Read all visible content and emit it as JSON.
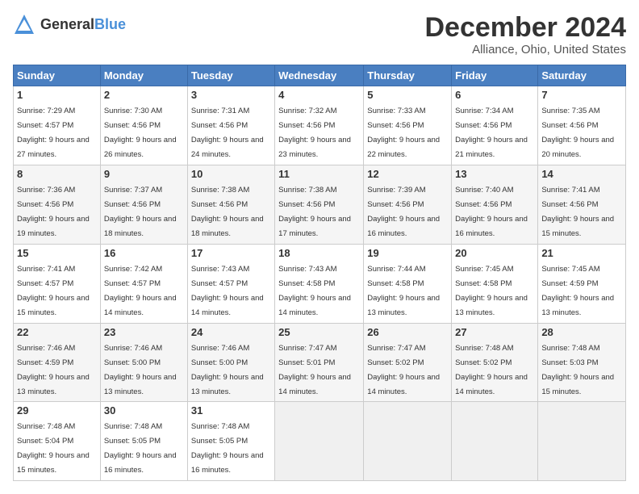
{
  "logo": {
    "general": "General",
    "blue": "Blue"
  },
  "title": "December 2024",
  "location": "Alliance, Ohio, United States",
  "days_header": [
    "Sunday",
    "Monday",
    "Tuesday",
    "Wednesday",
    "Thursday",
    "Friday",
    "Saturday"
  ],
  "weeks": [
    [
      {
        "day": "1",
        "sunrise": "7:29 AM",
        "sunset": "4:57 PM",
        "daylight": "9 hours and 27 minutes."
      },
      {
        "day": "2",
        "sunrise": "7:30 AM",
        "sunset": "4:56 PM",
        "daylight": "9 hours and 26 minutes."
      },
      {
        "day": "3",
        "sunrise": "7:31 AM",
        "sunset": "4:56 PM",
        "daylight": "9 hours and 24 minutes."
      },
      {
        "day": "4",
        "sunrise": "7:32 AM",
        "sunset": "4:56 PM",
        "daylight": "9 hours and 23 minutes."
      },
      {
        "day": "5",
        "sunrise": "7:33 AM",
        "sunset": "4:56 PM",
        "daylight": "9 hours and 22 minutes."
      },
      {
        "day": "6",
        "sunrise": "7:34 AM",
        "sunset": "4:56 PM",
        "daylight": "9 hours and 21 minutes."
      },
      {
        "day": "7",
        "sunrise": "7:35 AM",
        "sunset": "4:56 PM",
        "daylight": "9 hours and 20 minutes."
      }
    ],
    [
      {
        "day": "8",
        "sunrise": "7:36 AM",
        "sunset": "4:56 PM",
        "daylight": "9 hours and 19 minutes."
      },
      {
        "day": "9",
        "sunrise": "7:37 AM",
        "sunset": "4:56 PM",
        "daylight": "9 hours and 18 minutes."
      },
      {
        "day": "10",
        "sunrise": "7:38 AM",
        "sunset": "4:56 PM",
        "daylight": "9 hours and 18 minutes."
      },
      {
        "day": "11",
        "sunrise": "7:38 AM",
        "sunset": "4:56 PM",
        "daylight": "9 hours and 17 minutes."
      },
      {
        "day": "12",
        "sunrise": "7:39 AM",
        "sunset": "4:56 PM",
        "daylight": "9 hours and 16 minutes."
      },
      {
        "day": "13",
        "sunrise": "7:40 AM",
        "sunset": "4:56 PM",
        "daylight": "9 hours and 16 minutes."
      },
      {
        "day": "14",
        "sunrise": "7:41 AM",
        "sunset": "4:56 PM",
        "daylight": "9 hours and 15 minutes."
      }
    ],
    [
      {
        "day": "15",
        "sunrise": "7:41 AM",
        "sunset": "4:57 PM",
        "daylight": "9 hours and 15 minutes."
      },
      {
        "day": "16",
        "sunrise": "7:42 AM",
        "sunset": "4:57 PM",
        "daylight": "9 hours and 14 minutes."
      },
      {
        "day": "17",
        "sunrise": "7:43 AM",
        "sunset": "4:57 PM",
        "daylight": "9 hours and 14 minutes."
      },
      {
        "day": "18",
        "sunrise": "7:43 AM",
        "sunset": "4:58 PM",
        "daylight": "9 hours and 14 minutes."
      },
      {
        "day": "19",
        "sunrise": "7:44 AM",
        "sunset": "4:58 PM",
        "daylight": "9 hours and 13 minutes."
      },
      {
        "day": "20",
        "sunrise": "7:45 AM",
        "sunset": "4:58 PM",
        "daylight": "9 hours and 13 minutes."
      },
      {
        "day": "21",
        "sunrise": "7:45 AM",
        "sunset": "4:59 PM",
        "daylight": "9 hours and 13 minutes."
      }
    ],
    [
      {
        "day": "22",
        "sunrise": "7:46 AM",
        "sunset": "4:59 PM",
        "daylight": "9 hours and 13 minutes."
      },
      {
        "day": "23",
        "sunrise": "7:46 AM",
        "sunset": "5:00 PM",
        "daylight": "9 hours and 13 minutes."
      },
      {
        "day": "24",
        "sunrise": "7:46 AM",
        "sunset": "5:00 PM",
        "daylight": "9 hours and 13 minutes."
      },
      {
        "day": "25",
        "sunrise": "7:47 AM",
        "sunset": "5:01 PM",
        "daylight": "9 hours and 14 minutes."
      },
      {
        "day": "26",
        "sunrise": "7:47 AM",
        "sunset": "5:02 PM",
        "daylight": "9 hours and 14 minutes."
      },
      {
        "day": "27",
        "sunrise": "7:48 AM",
        "sunset": "5:02 PM",
        "daylight": "9 hours and 14 minutes."
      },
      {
        "day": "28",
        "sunrise": "7:48 AM",
        "sunset": "5:03 PM",
        "daylight": "9 hours and 15 minutes."
      }
    ],
    [
      {
        "day": "29",
        "sunrise": "7:48 AM",
        "sunset": "5:04 PM",
        "daylight": "9 hours and 15 minutes."
      },
      {
        "day": "30",
        "sunrise": "7:48 AM",
        "sunset": "5:05 PM",
        "daylight": "9 hours and 16 minutes."
      },
      {
        "day": "31",
        "sunrise": "7:48 AM",
        "sunset": "5:05 PM",
        "daylight": "9 hours and 16 minutes."
      },
      null,
      null,
      null,
      null
    ]
  ],
  "labels": {
    "sunrise": "Sunrise:",
    "sunset": "Sunset:",
    "daylight": "Daylight:"
  }
}
